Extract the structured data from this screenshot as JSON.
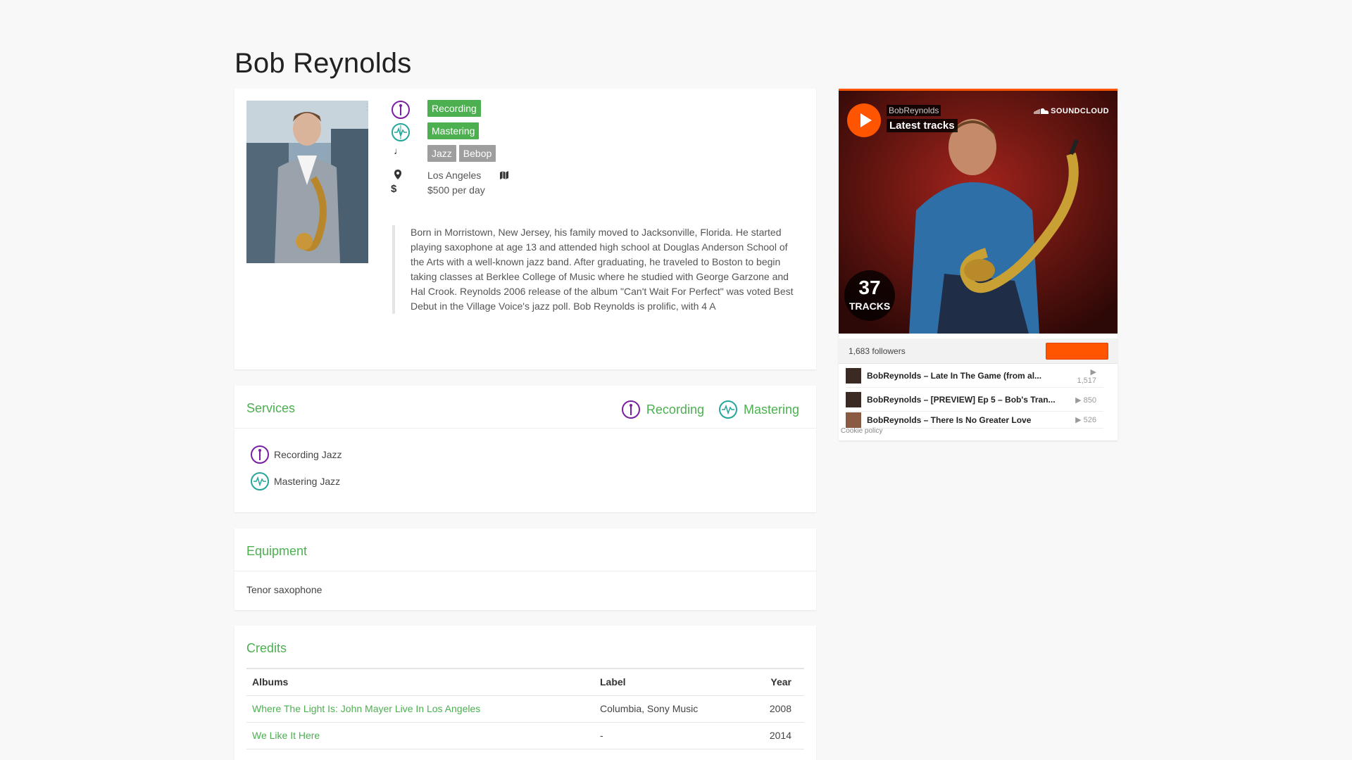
{
  "artist": {
    "name": "Bob Reynolds",
    "tags": {
      "services": [
        "Recording",
        "Mastering"
      ],
      "genres": [
        "Jazz",
        "Bebop"
      ]
    },
    "location": "Los Angeles",
    "rate": "$500 per day",
    "bio": "Born in Morristown, New Jersey, his family moved to Jacksonville, Florida. He started playing saxophone at age 13 and attended high school at Douglas Anderson School of the Arts with a well-known jazz band. After graduating, he traveled to Boston to begin taking classes at Berklee College of Music where he studied with George Garzone and Hal Crook. Reynolds 2006 release of the album \"Can't Wait For Perfect\" was voted Best Debut in the Village Voice's jazz poll. Bob Reynolds is prolific, with 4 A"
  },
  "services": {
    "title": "Services",
    "header_items": [
      "Recording",
      "Mastering"
    ],
    "list": [
      "Recording Jazz",
      "Mastering Jazz"
    ]
  },
  "equipment": {
    "title": "Equipment",
    "items": [
      "Tenor saxophone"
    ]
  },
  "credits": {
    "title": "Credits",
    "columns": [
      "Albums",
      "Label",
      "Year"
    ],
    "rows": [
      {
        "album": "Where The Light Is: John Mayer Live In Los Angeles",
        "label": "Columbia, Sony Music",
        "year": "2008"
      },
      {
        "album": "We Like It Here",
        "label": "-",
        "year": "2014"
      }
    ]
  },
  "soundcloud": {
    "user": "BobReynolds",
    "title": "Latest tracks",
    "brand": "SOUNDCLOUD",
    "track_count": "37",
    "track_count_label": "TRACKS",
    "followers": "1,683 followers",
    "tracks": [
      {
        "title": "BobReynolds – Late In The Game (from al...",
        "plays": "1,517"
      },
      {
        "title": "BobReynolds – [PREVIEW] Ep 5 – Bob's Tran...",
        "plays": "850"
      },
      {
        "title": "BobReynolds – There Is No Greater Love",
        "plays": "526"
      }
    ],
    "cookie": "Cookie policy"
  },
  "colors": {
    "accent_green": "#4caf50",
    "recording_icon": "#7b1fa2",
    "mastering_icon": "#26a69a",
    "soundcloud_orange": "#ff5500"
  }
}
